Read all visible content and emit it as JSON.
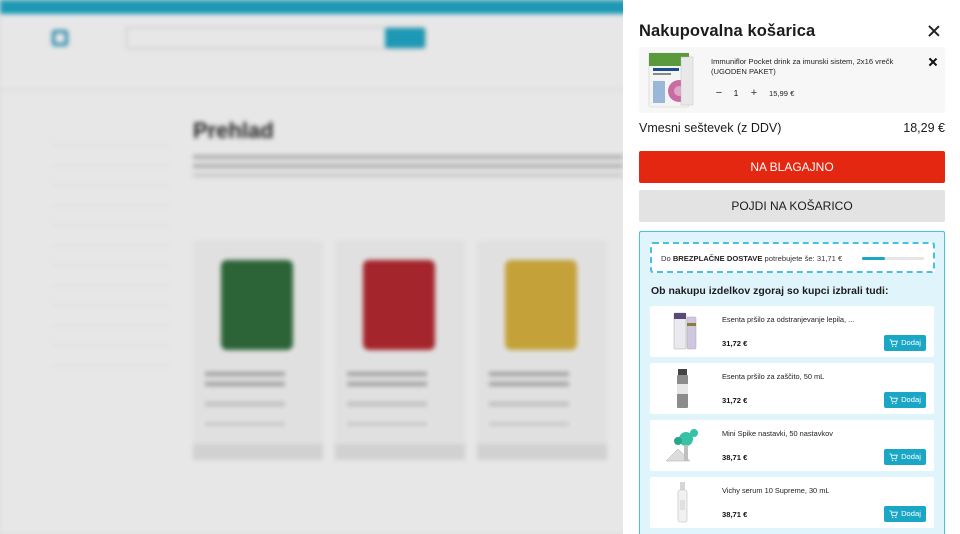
{
  "background_page": {
    "store_name": "",
    "main_heading": "Prehlad"
  },
  "drawer": {
    "title": "Nakupovalna košarica",
    "cart_item": {
      "name": "Immuniflor Pocket drink za imunski sistem, 2x16 vrečk (UGODEN PAKET)",
      "quantity": "1",
      "price": "15,99 €",
      "image_icon": "product-box-icon"
    },
    "subtotal_label": "Vmesni seštevek (z DDV)",
    "subtotal_value": "18,29 €",
    "checkout_label": "NA BLAGAJNO",
    "view_cart_label": "POJDI NA KOŠARICO",
    "shipping": {
      "prefix": "Do ",
      "bold": "BREZPLAČNE DOSTAVE",
      "suffix": " potrebujete še: 31,71 €",
      "progress": 0.37
    },
    "reco_title": "Ob nakupu izdelkov zgoraj so kupci izbrali tudi:",
    "reco_items": [
      {
        "name": "Esenta pršilo za odstranjevanje lepila, ...",
        "price": "31,72 €",
        "add_label": "Dodaj"
      },
      {
        "name": "Esenta pršilo za zaščito, 50 mL",
        "price": "31,72 €",
        "add_label": "Dodaj"
      },
      {
        "name": "Mini Spike nastavki, 50 nastavkov",
        "price": "38,71 €",
        "add_label": "Dodaj"
      },
      {
        "name": "Vichy serum 10 Supreme, 30 mL",
        "price": "38,71 €",
        "add_label": "Dodaj"
      }
    ]
  },
  "colors": {
    "accent": "#1aa7c6",
    "checkout": "#e32710",
    "secondary_button": "#e3e3e3",
    "reco_bg": "#dff4fb"
  }
}
